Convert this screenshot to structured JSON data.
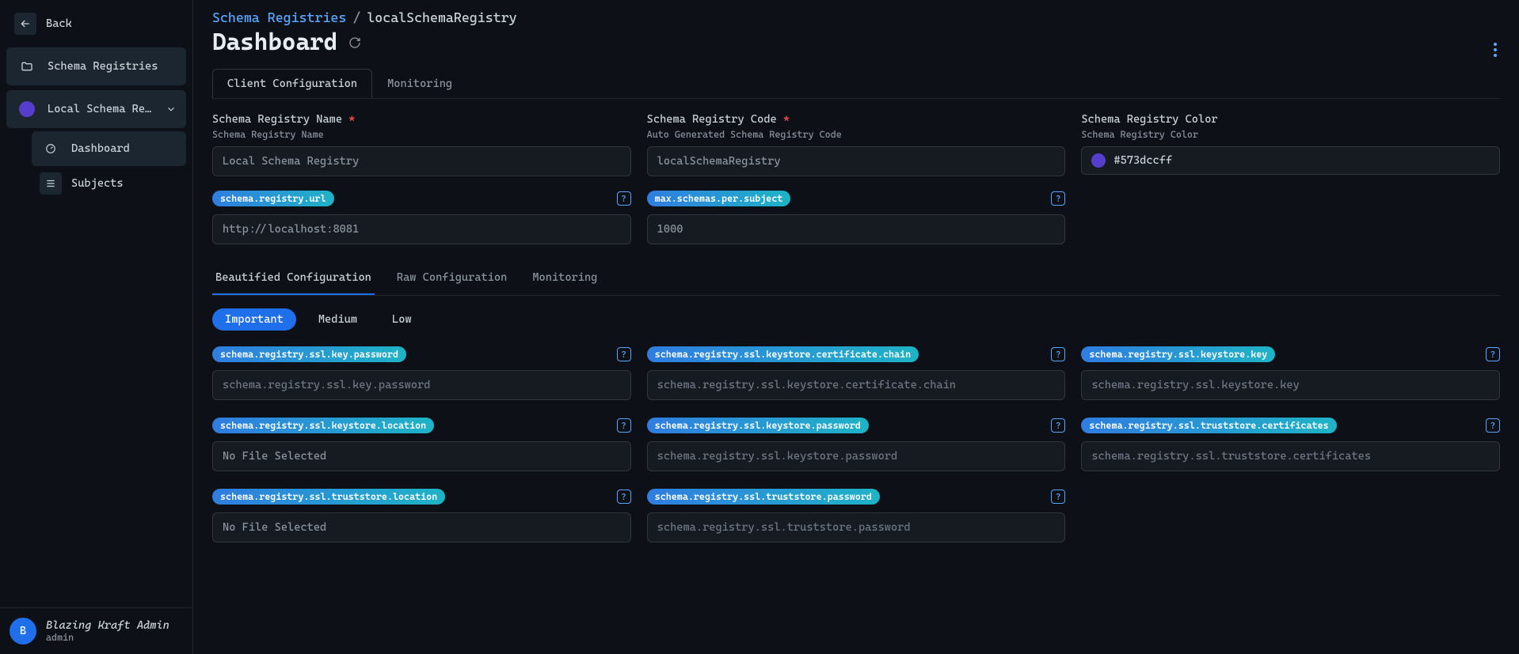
{
  "sidebar": {
    "back": "Back",
    "schema_registries": "Schema Registries",
    "local_item": "Local Schema Regi…",
    "dashboard": "Dashboard",
    "subjects": "Subjects"
  },
  "user": {
    "initial": "B",
    "name": "Blazing Kraft Admin",
    "role": "admin"
  },
  "breadcrumb": {
    "root": "Schema Registries",
    "sep": "/",
    "current": "localSchemaRegistry"
  },
  "page_title": "Dashboard",
  "main_tabs": {
    "client_config": "Client Configuration",
    "monitoring": "Monitoring"
  },
  "fields": {
    "name_label": "Schema Registry Name",
    "name_sub": "Schema Registry Name",
    "name_value": "Local Schema Registry",
    "code_label": "Schema Registry Code",
    "code_sub": "Auto Generated Schema Registry Code",
    "code_value": "localSchemaRegistry",
    "color_label": "Schema Registry Color",
    "color_sub": "Schema Registry Color",
    "color_value": "#573dccff"
  },
  "props_top": {
    "url_label": "schema.registry.url",
    "url_value": "http://localhost:8081",
    "max_label": "max.schemas.per.subject",
    "max_value": "1000"
  },
  "subtabs": {
    "beautified": "Beautified Configuration",
    "raw": "Raw Configuration",
    "monitoring": "Monitoring"
  },
  "filters": {
    "important": "Important",
    "medium": "Medium",
    "low": "Low"
  },
  "no_file": "No File Selected",
  "props": {
    "key_password": "schema.registry.ssl.key.password",
    "keystore_cert_chain": "schema.registry.ssl.keystore.certificate.chain",
    "keystore_key": "schema.registry.ssl.keystore.key",
    "keystore_location": "schema.registry.ssl.keystore.location",
    "keystore_password": "schema.registry.ssl.keystore.password",
    "truststore_certs": "schema.registry.ssl.truststore.certificates",
    "truststore_location": "schema.registry.ssl.truststore.location",
    "truststore_password": "schema.registry.ssl.truststore.password"
  }
}
